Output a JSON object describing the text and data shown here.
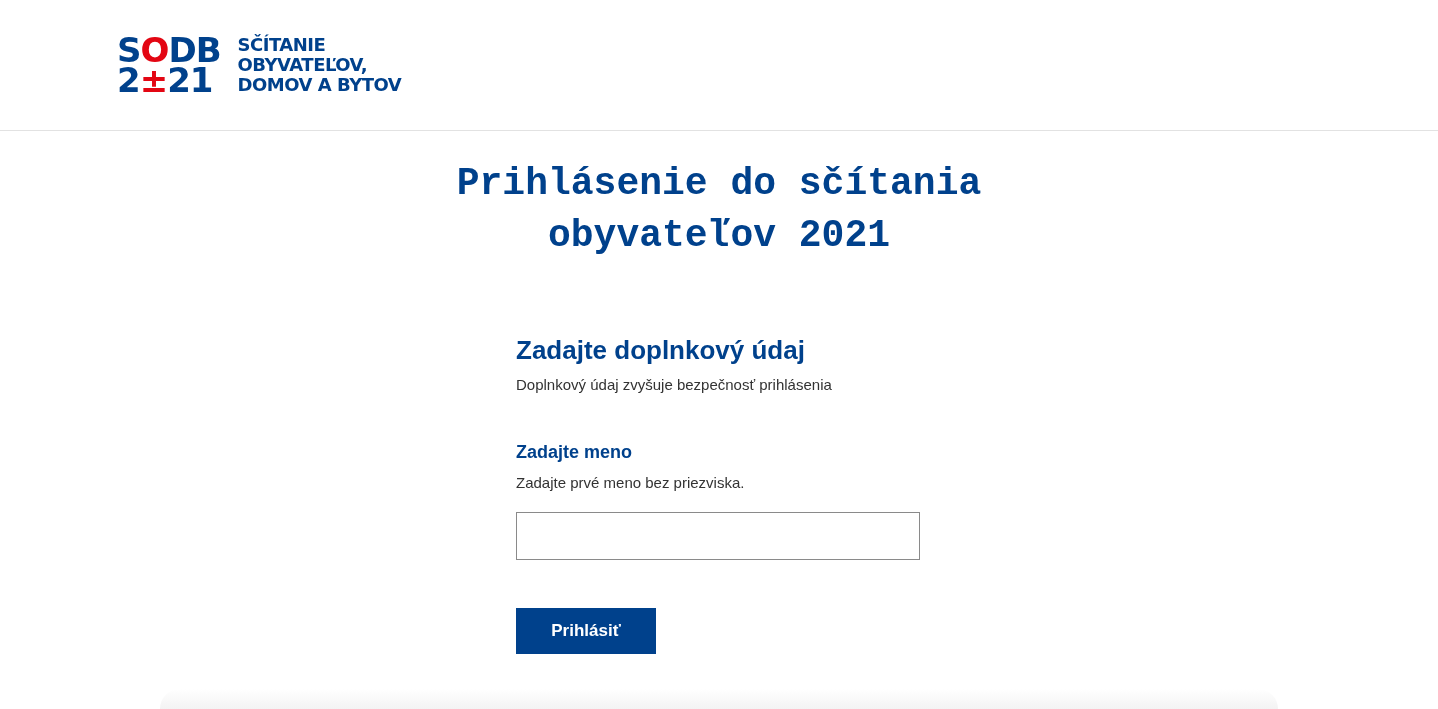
{
  "logo": {
    "mark_rows": [
      [
        {
          "text": "S",
          "accent": false
        },
        {
          "text": "O",
          "accent": true
        },
        {
          "text": "DB",
          "accent": false
        }
      ],
      [
        {
          "text": "2",
          "accent": false
        },
        {
          "text": "±",
          "accent": true
        },
        {
          "text": "21",
          "accent": false
        }
      ]
    ],
    "wordmark_lines": [
      "SČÍTANIE",
      "OBYVATEĽOV,",
      "DOMOV A BYTOV"
    ]
  },
  "page_title": "Prihlásenie do sčítania obyvateľov 2021",
  "form": {
    "heading": "Zadajte doplnkový údaj",
    "subheading": "Doplnkový údaj zvyšuje bezpečnosť prihlásenia",
    "field": {
      "label": "Zadajte meno",
      "hint": "Zadajte prvé meno bez priezviska."
    },
    "submit": "Prihlásiť"
  }
}
